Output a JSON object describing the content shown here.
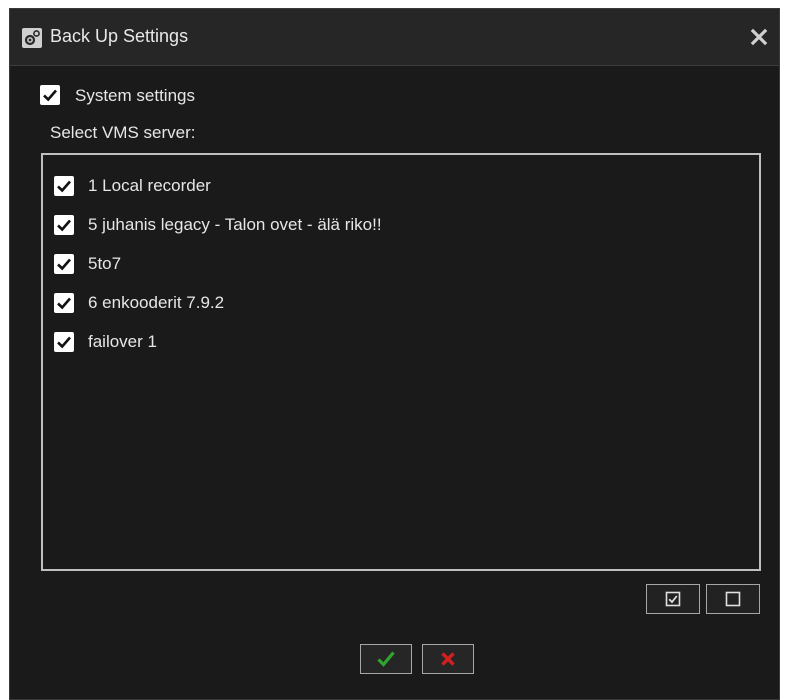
{
  "dialog": {
    "title": "Back Up Settings",
    "icon": "gear-icon",
    "close_icon": "close-icon"
  },
  "system_settings": {
    "label": "System settings",
    "checked": true
  },
  "server_section": {
    "label": "Select VMS server:"
  },
  "servers": [
    {
      "label": "1  Local recorder",
      "checked": true
    },
    {
      "label": "5  juhanis legacy - Talon ovet - älä riko!!",
      "checked": true
    },
    {
      "label": "5to7",
      "checked": true
    },
    {
      "label": "6  enkooderit 7.9.2",
      "checked": true
    },
    {
      "label": "failover 1",
      "checked": true
    }
  ],
  "list_controls": {
    "select_all_icon": "checked-box-icon",
    "select_none_icon": "empty-box-icon"
  },
  "actions": {
    "ok_icon": "checkmark-icon",
    "cancel_icon": "x-icon"
  },
  "colors": {
    "background": "#1a1a1a",
    "titlebar": "#262626",
    "ok_green": "#2fa52f",
    "cancel_red": "#d22020",
    "text": "#e6e6e6"
  }
}
